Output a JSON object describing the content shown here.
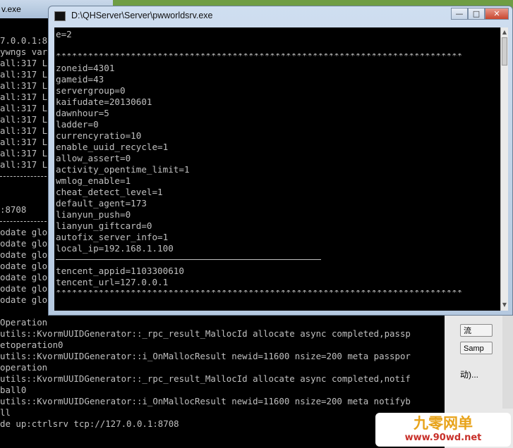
{
  "bg_window": {
    "title": "v.exe",
    "top_lines": [
      "7.0.0.1:8",
      "ywngs vars",
      "all:317 L",
      "all:317 L",
      "all:317 L",
      "all:317 L",
      "all:317 L",
      "all:317 L",
      "all:317 L",
      "all:317 L",
      "all:317 L",
      "all:317 L"
    ],
    "addr_line": ":8708",
    "update_lines": [
      "odate glo",
      "odate glo",
      "odate glo",
      "odate glo",
      "odate glo",
      "odate glo",
      "odate glo"
    ],
    "bottom_lines": [
      "Operation",
      "utils::KvormUUIDGenerator::_rpc_result_MallocId allocate async completed,passp",
      "etoperation0",
      "utils::KvormUUIDGenerator::i_OnMallocResult newid=11600 nsize=200 meta passpor",
      "operation",
      "utils::KvormUUIDGenerator::_rpc_result_MallocId allocate async completed,notif",
      "ball0",
      "utils::KvormUUIDGenerator::i_OnMallocResult newid=11600 nsize=200 meta notifyb",
      "ll",
      "de up:ctrlsrv tcp://127.0.0.1:8708"
    ]
  },
  "right_panel": {
    "button1_label": "流",
    "button2_label": "Samp",
    "text": "动)..."
  },
  "fg_window": {
    "title": "D:\\QHServer\\Server\\pwworldsrv.exe",
    "controls": {
      "minimize": "—",
      "maximize": "□",
      "close": "✕"
    },
    "first_line": "e=2",
    "rule": "****************************************************************************",
    "config_lines": [
      "zoneid=4301",
      "gameid=43",
      "servergroup=0",
      "kaifudate=20130601",
      "dawnhour=5",
      "ladder=0",
      "currencyratio=10",
      "enable_uuid_recycle=1",
      "allow_assert=0",
      "activity_opentime_limit=1",
      "wmlog_enable=1",
      "cheat_detect_level=1",
      "default_agent=173",
      "lianyun_push=0",
      "lianyun_giftcard=0",
      "autofix_server_info=1",
      "local_ip=192.168.1.100"
    ],
    "tencent_lines": [
      "tencent_appid=1103300610",
      "tencent_url=127.0.0.1"
    ]
  },
  "watermark": {
    "cn": "九零网单",
    "url": "www.90wd.net"
  },
  "colors": {
    "console_bg": "#000000",
    "console_text": "#c0c0c0",
    "desktop": "#6f9d44",
    "watermark_cn": "#e8a31a",
    "watermark_url": "#c8302a"
  }
}
